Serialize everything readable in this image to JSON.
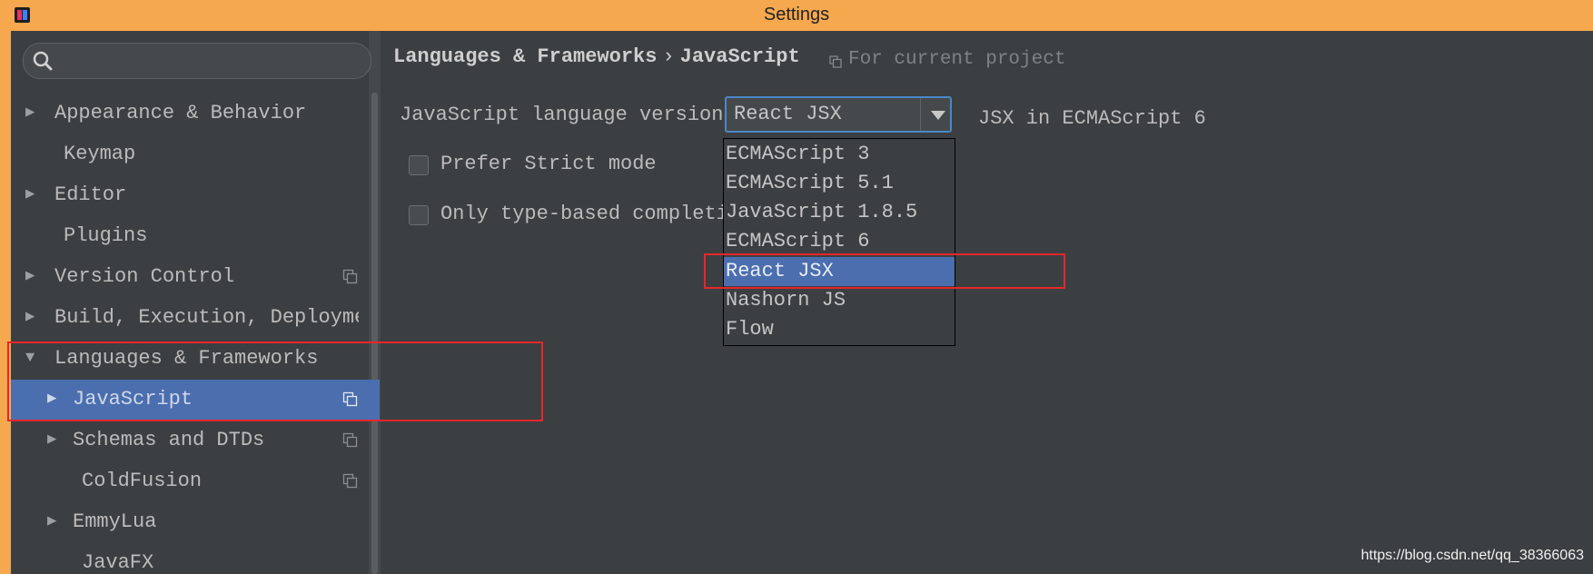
{
  "window": {
    "title": "Settings"
  },
  "search": {
    "value": "",
    "placeholder": ""
  },
  "sidebar": {
    "items": [
      {
        "label": "Appearance & Behavior",
        "arrow": "▶"
      },
      {
        "label": "Keymap",
        "arrow": ""
      },
      {
        "label": "Editor",
        "arrow": "▶"
      },
      {
        "label": "Plugins",
        "arrow": ""
      },
      {
        "label": "Version Control",
        "arrow": "▶"
      },
      {
        "label": "Build, Execution, Deployment",
        "arrow": "▶"
      },
      {
        "label": "Languages & Frameworks",
        "arrow": "▼"
      },
      {
        "label": "JavaScript",
        "arrow": "▶"
      },
      {
        "label": "Schemas and DTDs",
        "arrow": "▶"
      },
      {
        "label": "ColdFusion",
        "arrow": ""
      },
      {
        "label": "EmmyLua",
        "arrow": "▶"
      },
      {
        "label": "JavaFX",
        "arrow": ""
      }
    ]
  },
  "breadcrumb": {
    "parent": "Languages & Frameworks",
    "separator": "›",
    "current": "JavaScript",
    "scope": "For current project"
  },
  "settings": {
    "language_version_label": "JavaScript language version",
    "language_version_value": "React JSX",
    "language_version_desc": "JSX in ECMAScript 6",
    "prefer_strict_label": "Prefer Strict mode",
    "prefer_strict_checked": false,
    "type_based_label": "Only type-based completion",
    "type_based_checked": false
  },
  "dropdown": {
    "options": [
      "ECMAScript 3",
      "ECMAScript 5.1",
      "JavaScript 1.8.5",
      "ECMAScript 6",
      "React JSX",
      "Nashorn JS",
      "Flow"
    ],
    "selected": "React JSX"
  },
  "watermark": "https://blog.csdn.net/qq_38366063",
  "colors": {
    "title_bar": "#f6a84f",
    "background": "#3c3f41",
    "selection": "#4b6eaf",
    "focus_border": "#4a88c7",
    "annotation_red": "#e8262b"
  }
}
